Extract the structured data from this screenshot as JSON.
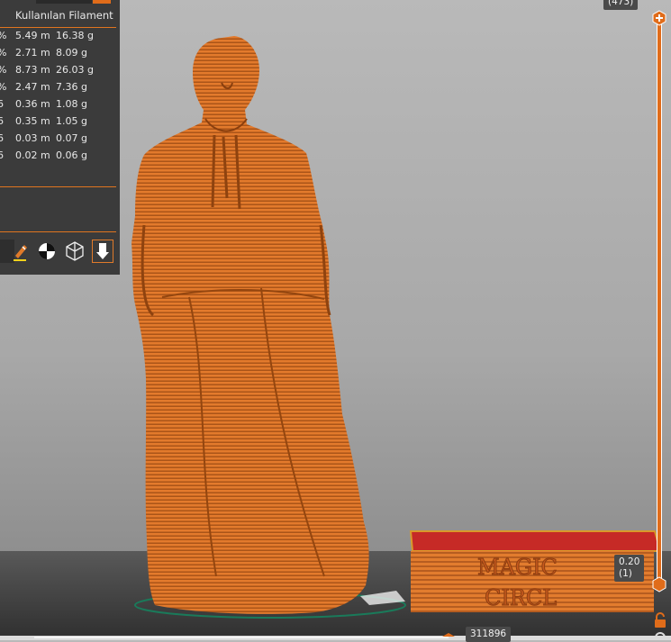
{
  "panel": {
    "header": "Kullanılan Filament",
    "rows": [
      {
        "pct": "%",
        "length": "5.49 m",
        "weight": "16.38 g"
      },
      {
        "pct": "%",
        "length": "2.71 m",
        "weight": "8.09 g"
      },
      {
        "pct": "%",
        "length": "8.73 m",
        "weight": "26.03 g"
      },
      {
        "pct": "%",
        "length": "2.47 m",
        "weight": "7.36 g"
      },
      {
        "pct": "6",
        "length": "0.36 m",
        "weight": "1.08 g"
      },
      {
        "pct": "6",
        "length": "0.35 m",
        "weight": "1.05 g"
      },
      {
        "pct": "6",
        "length": "0.03 m",
        "weight": "0.07 g"
      },
      {
        "pct": "6",
        "length": "0.02 m",
        "weight": "0.06 g"
      }
    ],
    "toolbar": [
      "paint-brush-icon",
      "seam-icon",
      "cube-wireframe-icon",
      "export-icon"
    ]
  },
  "slider": {
    "top_value": "",
    "top_layer": "(473)",
    "bottom_value": "0.20",
    "bottom_layer": "(1)"
  },
  "moves_counter": "311896",
  "box_text": [
    "MAGIC",
    "CIRCL"
  ],
  "colors": {
    "accent": "#e06c1a",
    "model": "#e0762a",
    "panel": "#3b3b3b"
  }
}
